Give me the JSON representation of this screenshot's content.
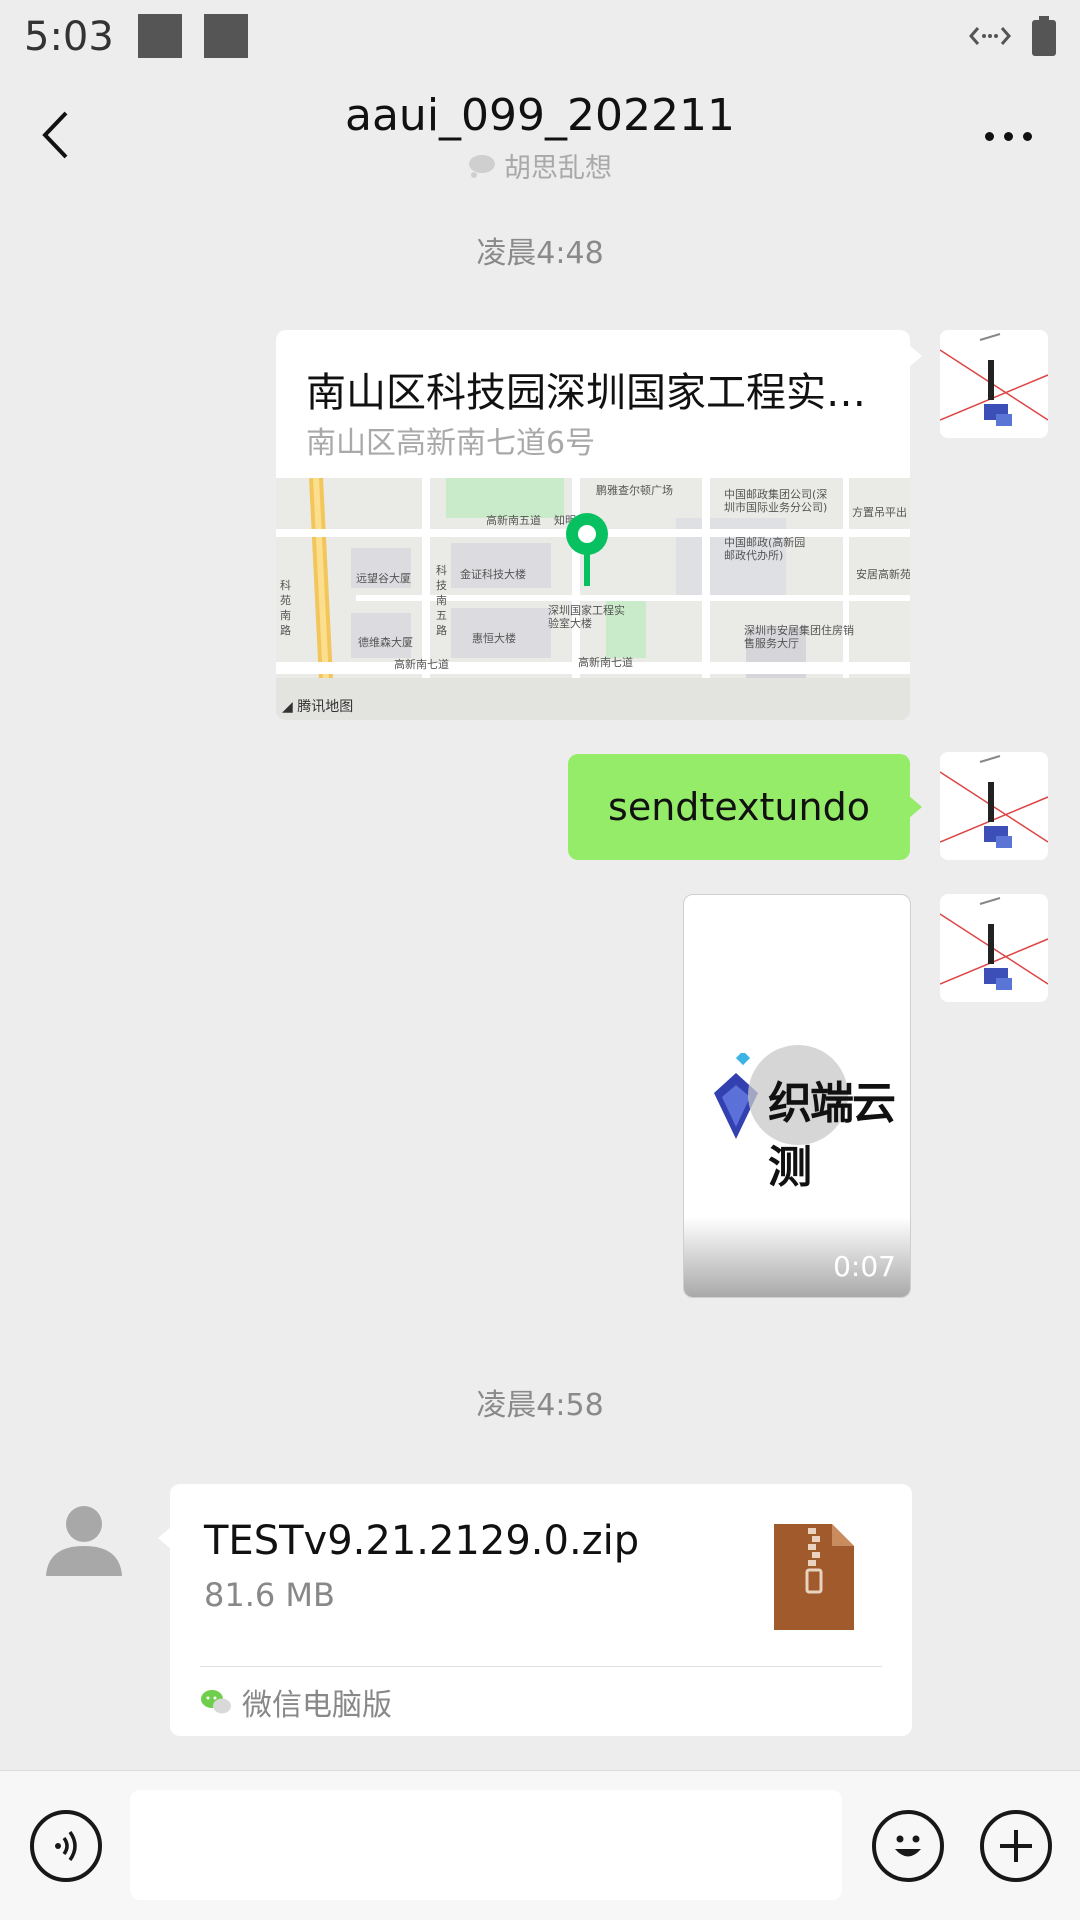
{
  "status_bar": {
    "time": "5:03"
  },
  "header": {
    "title": "aaui_099_202211",
    "subtitle": "胡思乱想"
  },
  "messages": {
    "time1": "凌晨4:48",
    "location": {
      "title": "南山区科技园深圳国家工程实…",
      "address": "南山区高新南七道6号",
      "map_credit": "腾讯地图",
      "map_labels": [
        "高新南五道",
        "知明",
        "远望谷大厦",
        "金证科技大楼",
        "深圳国家工程实验室大楼",
        "德维森大厦",
        "惠恒大楼",
        "高新南七道",
        "高新南七道",
        "中国邮政集团公司(深圳市国际业务分公司)",
        "中国邮政(高新园邮政代办所)",
        "方置吊平出",
        "安居高新苑",
        "深圳市安居集团住房销售服务大厅",
        "科苑南路",
        "科技南五路",
        "鹏雅查尔顿广场"
      ]
    },
    "text_bubble": "sendtextundo",
    "video": {
      "duration": "0:07",
      "thumbnail_text": "织端云测"
    },
    "time2": "凌晨4:58",
    "file": {
      "name": "TESTv9.21.2129.0.zip",
      "size": "81.6 MB",
      "source": "微信电脑版"
    }
  },
  "colors": {
    "bubble_green": "#95ec69",
    "pin_green": "#07c160",
    "background": "#ededed"
  }
}
